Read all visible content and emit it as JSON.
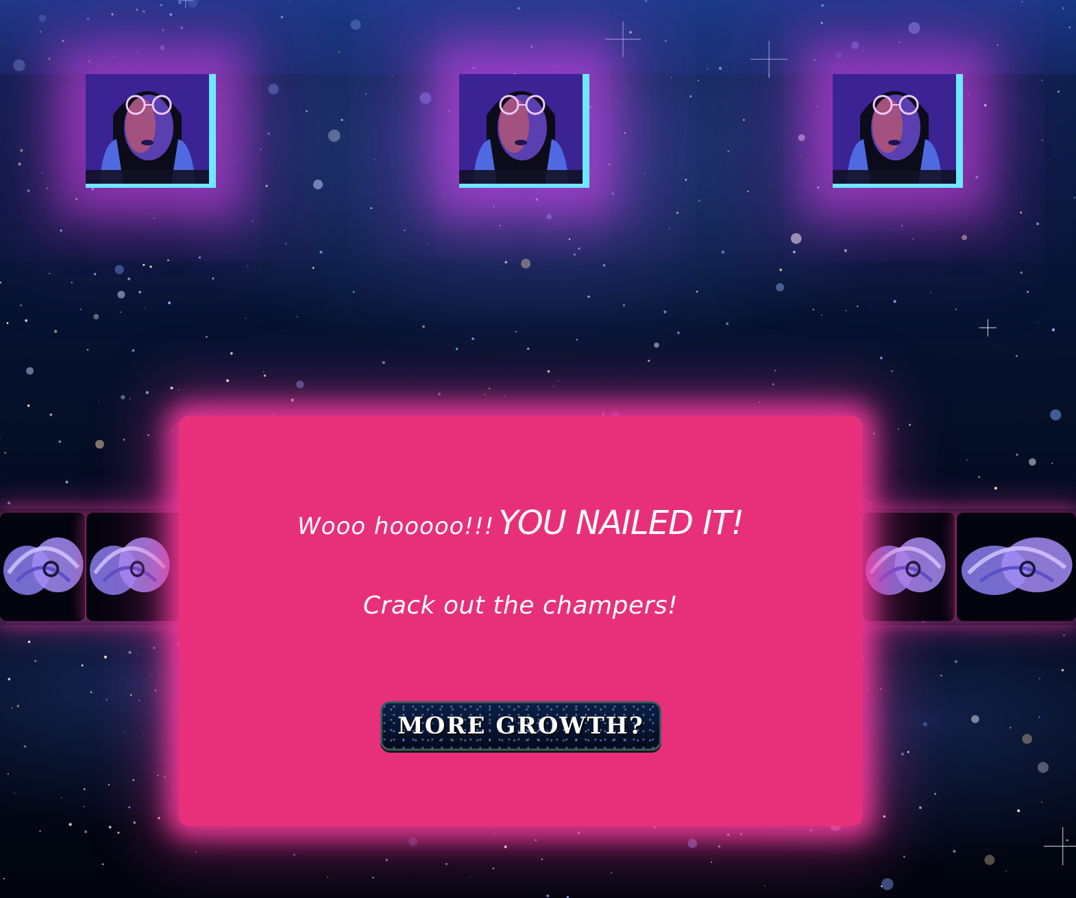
{
  "theme": {
    "accent_pink": "#e8307a",
    "glow_magenta": "#dc46f0",
    "frame_cyan": "#6ee8ff",
    "space_navy": "#061331"
  },
  "gallery_top": {
    "items": [
      {
        "kind": "portrait",
        "icon": "neon-glasses-portrait-icon"
      },
      {
        "kind": "portrait",
        "icon": "neon-glasses-portrait-icon"
      },
      {
        "kind": "portrait",
        "icon": "neon-glasses-portrait-icon"
      }
    ]
  },
  "gallery_strip": {
    "icon": "purple-swirl-icon"
  },
  "dialog": {
    "headline_small": "Wooo hooooo!!!",
    "headline_big": "YOU NAILED IT!",
    "subline": "Crack out the champers!",
    "button_label": "MORE GROWTH?"
  }
}
